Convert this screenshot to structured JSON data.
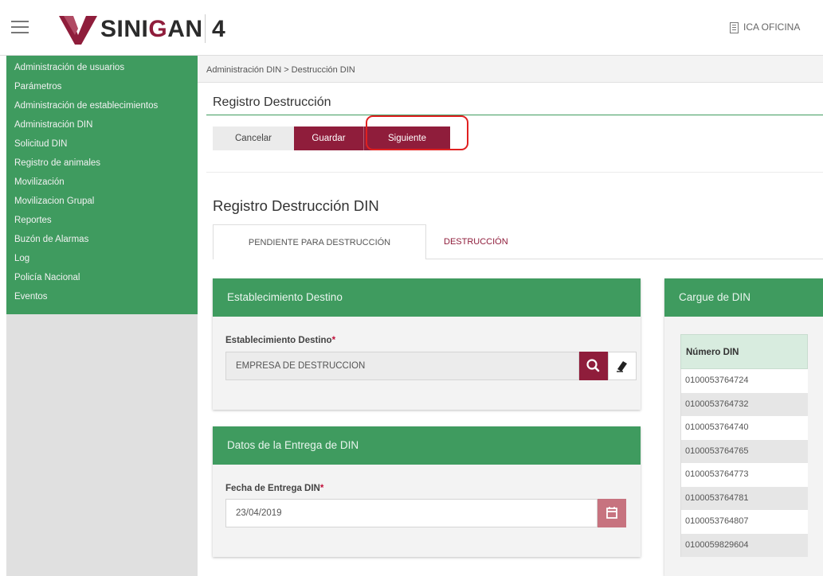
{
  "header": {
    "brand_prefix": "SINI",
    "brand_g": "G",
    "brand_suffix": "AN",
    "version": "4",
    "office": "ICA OFICINA"
  },
  "sidebar": {
    "items": [
      {
        "label": "Administración de usuarios"
      },
      {
        "label": "Parámetros"
      },
      {
        "label": "Administración de establecimientos"
      },
      {
        "label": "Administración DIN"
      },
      {
        "label": "Solicitud DIN"
      },
      {
        "label": "Registro de animales"
      },
      {
        "label": "Movilización"
      },
      {
        "label": "Movilizacion Grupal"
      },
      {
        "label": "Reportes"
      },
      {
        "label": "Buzón de Alarmas"
      },
      {
        "label": "Log"
      },
      {
        "label": "Policía Nacional"
      },
      {
        "label": "Eventos"
      }
    ]
  },
  "breadcrumb": "Administración DIN > Destrucción DIN",
  "section_title": "Registro Destrucción",
  "toolbar": {
    "cancel_label": "Cancelar",
    "save_label": "Guardar",
    "next_label": "Siguiente"
  },
  "subtitle": "Registro Destrucción DIN",
  "tabs": [
    {
      "label": "PENDIENTE PARA DESTRUCCIÓN"
    },
    {
      "label": "DESTRUCCIÓN"
    }
  ],
  "destino_card": {
    "title": "Establecimiento Destino",
    "field_label": "Establecimiento Destino",
    "required_mark": "*",
    "value": "EMPRESA DE DESTRUCCION"
  },
  "entrega_card": {
    "title": "Datos de la Entrega de DIN",
    "field_label": "Fecha de Entrega DIN",
    "required_mark": "*",
    "value": "23/04/2019"
  },
  "cargue_card": {
    "title": "Cargue de DIN",
    "column_header": "Número DIN",
    "rows": [
      "0100053764724",
      "0100053764732",
      "0100053764740",
      "0100053764765",
      "0100053764773",
      "0100053764781",
      "0100053764807",
      "0100059829604"
    ]
  },
  "colors": {
    "green": "#3f9b5f",
    "maroon": "#8f1d3b",
    "highlight": "#e02020"
  },
  "icons": [
    "menu-icon",
    "logo-icon",
    "building-icon",
    "search-icon",
    "eraser-icon",
    "calendar-icon"
  ]
}
